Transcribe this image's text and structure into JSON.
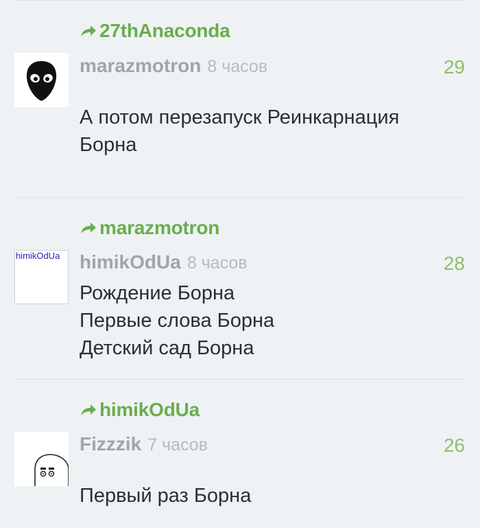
{
  "comments": [
    {
      "reply_to": "27thAnaconda",
      "author": "marazmotron",
      "time": "8 часов",
      "rating": "29",
      "avatar_icon": "alien-head-icon",
      "lines": [
        "А потом перезапуск Реинкарнация",
        "Борна"
      ]
    },
    {
      "reply_to": "marazmotron",
      "author": "himikOdUa",
      "time": "8 часов",
      "rating": "28",
      "avatar_text": "himikOdUa",
      "lines": [
        "Рождение Борна",
        "Первые слова Борна",
        "Детский сад Борна"
      ]
    },
    {
      "reply_to": "himikOdUa",
      "author": "Fizzzik",
      "time": "7 часов",
      "rating": "26",
      "avatar_icon": "cartoon-face-icon",
      "lines": [
        "Первый раз Борна"
      ]
    }
  ],
  "colors": {
    "background": "#eff2f4",
    "reply_link": "#6aad4c",
    "rating": "#8fbe6b",
    "author": "#9fa6aa",
    "time": "#b5bbbf",
    "body": "#2b2f33"
  }
}
